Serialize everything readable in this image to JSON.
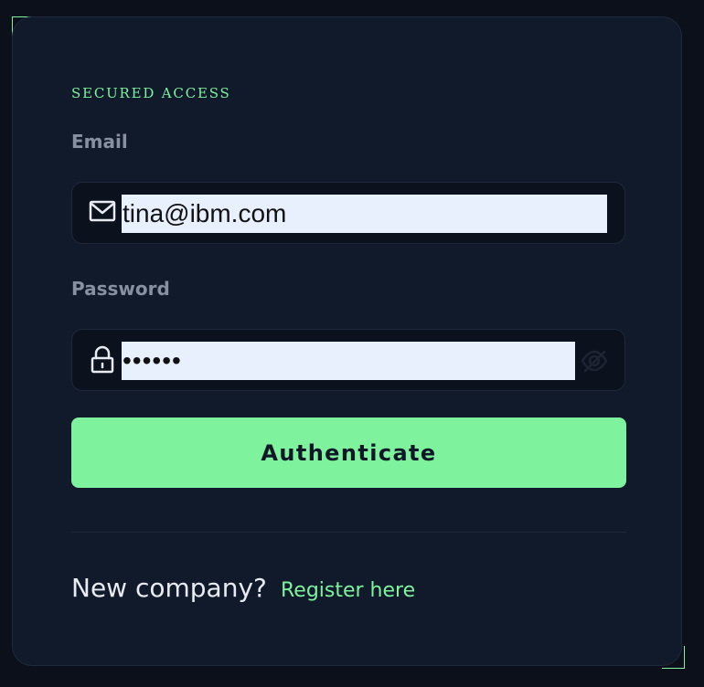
{
  "login": {
    "eyebrow": "SECURED ACCESS",
    "email": {
      "label": "Email",
      "value": "tina@ibm.com",
      "icon": "mail-icon"
    },
    "password": {
      "label": "Password",
      "value": "••••••",
      "icon": "lock-icon",
      "toggle_icon": "eye-off-icon"
    },
    "submit_label": "Authenticate",
    "footer": {
      "question": "New company?",
      "link_label": "Register here"
    }
  },
  "colors": {
    "page_background": "#0b101b",
    "card_background": "#111a2b",
    "input_background": "#0b111d",
    "autofill_background": "#e8f0fe",
    "accent": "#7ef29d",
    "muted_label": "#8790a0",
    "text_primary": "#e8ebf2"
  }
}
